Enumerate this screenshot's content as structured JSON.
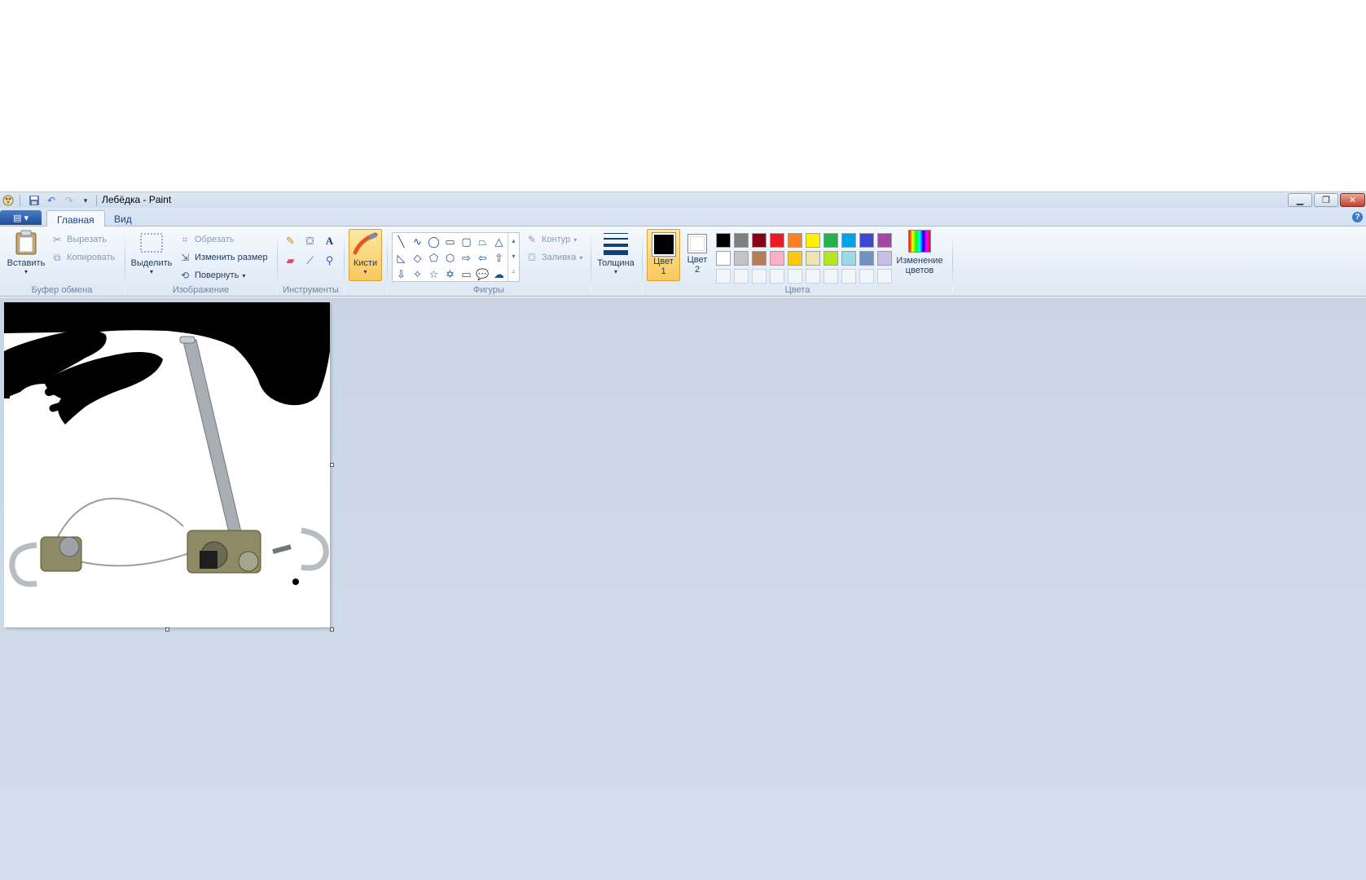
{
  "window": {
    "title": "Лебёдка - Paint"
  },
  "tabs": [
    {
      "label": "Главная",
      "active": true
    },
    {
      "label": "Вид",
      "active": false
    }
  ],
  "ribbon": {
    "clipboard": {
      "group_label": "Буфер обмена",
      "paste": "Вставить",
      "cut": "Вырезать",
      "copy": "Копировать"
    },
    "image": {
      "group_label": "Изображение",
      "select": "Выделить",
      "crop": "Обрезать",
      "resize": "Изменить размер",
      "rotate": "Повернуть"
    },
    "tools": {
      "group_label": "Инструменты"
    },
    "brushes": {
      "label": "Кисти"
    },
    "shapes": {
      "group_label": "Фигуры",
      "outline": "Контур",
      "fill": "Заливка"
    },
    "size": {
      "label": "Толщина"
    },
    "colors": {
      "group_label": "Цвета",
      "color1_line1": "Цвет",
      "color1_line2": "1",
      "color2_line1": "Цвет",
      "color2_line2": "2",
      "edit_line1": "Изменение",
      "edit_line2": "цветов",
      "color1": "#000000",
      "color2": "#ffffff",
      "palette_row1": [
        "#000000",
        "#7f7f7f",
        "#880015",
        "#ed1c24",
        "#ff7f27",
        "#fff200",
        "#22b14c",
        "#00a2e8",
        "#3f48cc",
        "#a349a4"
      ],
      "palette_row2": [
        "#ffffff",
        "#c3c3c3",
        "#b97a57",
        "#ffaec9",
        "#ffc90e",
        "#efe4b0",
        "#b5e61d",
        "#99d9ea",
        "#7092be",
        "#c8bfe7"
      ]
    }
  },
  "icons": {
    "app": "paint-app-icon",
    "save": "save-icon",
    "undo": "undo-icon",
    "redo": "redo-icon"
  }
}
